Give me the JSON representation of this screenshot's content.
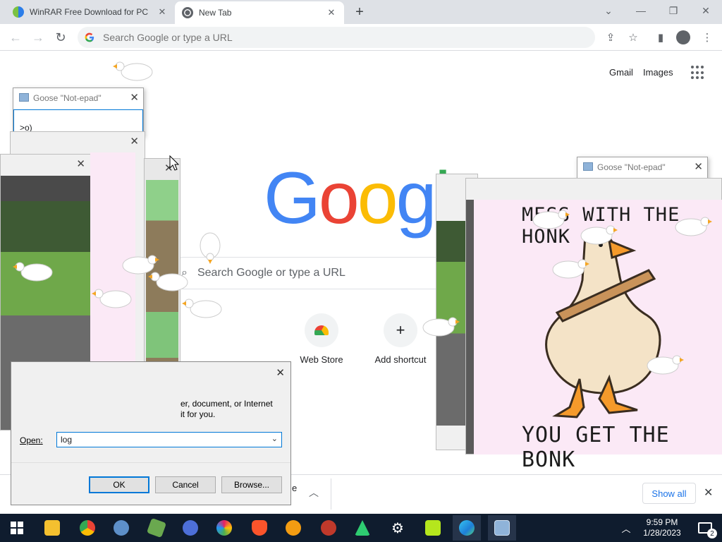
{
  "browser": {
    "tabs": [
      {
        "title": "WinRAR Free Download for PC",
        "active": false
      },
      {
        "title": "New Tab",
        "active": true
      }
    ],
    "omnibox_placeholder": "Search Google or type a URL"
  },
  "page": {
    "gmail_label": "Gmail",
    "images_label": "Images",
    "logo_text": "Google",
    "search_placeholder": "Search Google or type a URL",
    "shortcuts": [
      {
        "label": "Web Store"
      },
      {
        "label": "Add shortcut"
      }
    ]
  },
  "downloads_bar": {
    "show_all_label": "Show all",
    "partial_text": "e"
  },
  "goose_notepads": [
    {
      "title": "Goose \"Not-epad\"",
      "content": ">o)"
    },
    {
      "title": "Goose \"Not-epad\""
    }
  ],
  "run_dialog": {
    "description_line1": "er, document, or Internet",
    "description_line2": "it for you.",
    "open_label": "Open:",
    "open_value": "log",
    "ok_label": "OK",
    "cancel_label": "Cancel",
    "browse_label": "Browse..."
  },
  "poster": {
    "top_text": "MESS WITH THE HONK",
    "bottom_text": "YOU GET THE BONK"
  },
  "taskbar": {
    "time": "9:59 PM",
    "date": "1/28/2023",
    "notification_count": "2"
  },
  "colors": {
    "google_blue": "#4285f4",
    "google_red": "#ea4335",
    "google_yellow": "#fbbc05",
    "google_green": "#34a853",
    "taskbar_bg": "#0f1c2e",
    "link_blue": "#1a73e8"
  }
}
